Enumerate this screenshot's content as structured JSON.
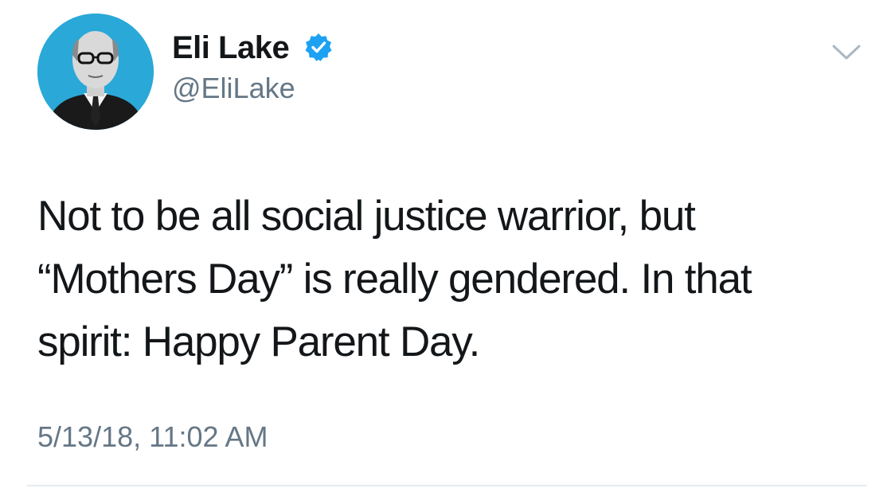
{
  "author": {
    "display_name": "Eli Lake",
    "handle": "@EliLake",
    "verified": true
  },
  "tweet": {
    "text": "Not to be all social justice warrior, but\n“Mothers Day” is really gendered. In that\nspirit: Happy Parent Day.",
    "timestamp": "5/13/18, 11:02 AM"
  },
  "icons": {
    "verified": "verified-badge-icon",
    "caret": "chevron-down-icon"
  },
  "colors": {
    "avatar_background": "#2aa8d8",
    "verified_blue": "#1da1f2",
    "secondary_text": "#657786",
    "primary_text": "#14171a"
  }
}
